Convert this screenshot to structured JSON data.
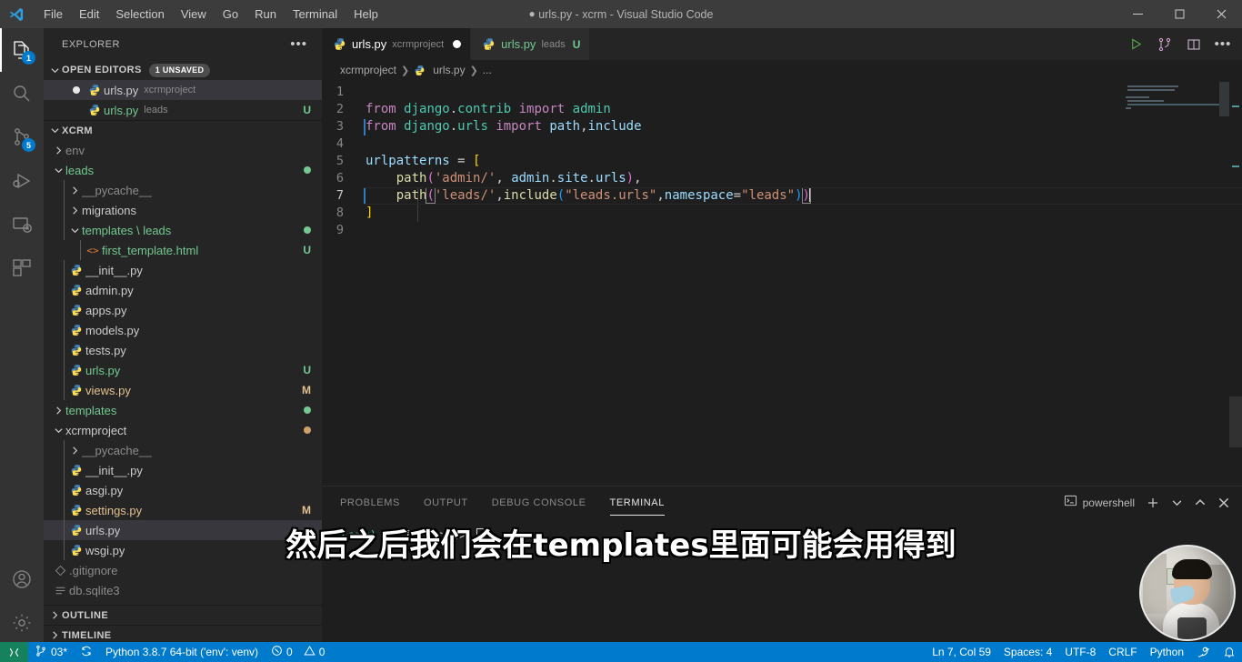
{
  "titlebar": {
    "logo_icon": "vscode-logo-icon",
    "menus": [
      "File",
      "Edit",
      "Selection",
      "View",
      "Go",
      "Run",
      "Terminal",
      "Help"
    ],
    "window_title": "urls.py - xcrm - Visual Studio Code",
    "dirty_indicator": "●",
    "controls": [
      "minimize-icon",
      "maximize-icon",
      "close-icon"
    ]
  },
  "activitybar": {
    "items": [
      {
        "name": "explorer",
        "icon": "files-icon",
        "badge": "1",
        "active": true
      },
      {
        "name": "search",
        "icon": "search-icon",
        "badge": "",
        "active": false
      },
      {
        "name": "source-control",
        "icon": "source-control-icon",
        "badge": "5",
        "active": false
      },
      {
        "name": "run-and-debug",
        "icon": "run-debug-icon",
        "badge": "",
        "active": false
      },
      {
        "name": "remote-explorer",
        "icon": "remote-explorer-icon",
        "badge": "",
        "active": false
      },
      {
        "name": "extensions",
        "icon": "extensions-icon",
        "badge": "",
        "active": false
      }
    ],
    "bottom": [
      {
        "name": "accounts",
        "icon": "account-icon"
      },
      {
        "name": "manage",
        "icon": "gear-icon"
      }
    ]
  },
  "sidebar": {
    "title": "EXPLORER",
    "more_actions_icon": "ellipsis-icon",
    "open_editors": {
      "label": "OPEN EDITORS",
      "badge": "1 UNSAVED",
      "expanded": true,
      "items": [
        {
          "name": "urls.py",
          "desc": "xcrmproject",
          "icon": "python-icon",
          "dirty": true,
          "state": ""
        },
        {
          "name": "urls.py",
          "desc": "leads",
          "icon": "python-icon",
          "dirty": false,
          "state": "U"
        }
      ]
    },
    "workspace": {
      "label": "XCRM",
      "expanded": true,
      "tree": [
        {
          "label": "env",
          "depth": 1,
          "kind": "folder",
          "open": false,
          "color": "grey",
          "state": "",
          "dot": ""
        },
        {
          "label": "leads",
          "depth": 1,
          "kind": "folder",
          "open": true,
          "color": "green",
          "state": "",
          "dot": "green"
        },
        {
          "label": "__pycache__",
          "depth": 2,
          "kind": "folder",
          "open": false,
          "color": "grey",
          "state": "",
          "dot": ""
        },
        {
          "label": "migrations",
          "depth": 2,
          "kind": "folder",
          "open": false,
          "color": "white",
          "state": "",
          "dot": ""
        },
        {
          "label": "templates \\ leads",
          "depth": 2,
          "kind": "folder",
          "open": true,
          "color": "green",
          "state": "",
          "dot": "green"
        },
        {
          "label": "first_template.html",
          "depth": 3,
          "kind": "html",
          "open": false,
          "color": "green",
          "state": "U",
          "dot": ""
        },
        {
          "label": "__init__.py",
          "depth": 2,
          "kind": "python",
          "open": false,
          "color": "white",
          "state": "",
          "dot": ""
        },
        {
          "label": "admin.py",
          "depth": 2,
          "kind": "python",
          "open": false,
          "color": "white",
          "state": "",
          "dot": ""
        },
        {
          "label": "apps.py",
          "depth": 2,
          "kind": "python",
          "open": false,
          "color": "white",
          "state": "",
          "dot": ""
        },
        {
          "label": "models.py",
          "depth": 2,
          "kind": "python",
          "open": false,
          "color": "white",
          "state": "",
          "dot": ""
        },
        {
          "label": "tests.py",
          "depth": 2,
          "kind": "python",
          "open": false,
          "color": "white",
          "state": "",
          "dot": ""
        },
        {
          "label": "urls.py",
          "depth": 2,
          "kind": "python",
          "open": false,
          "color": "green",
          "state": "U",
          "dot": ""
        },
        {
          "label": "views.py",
          "depth": 2,
          "kind": "python",
          "open": false,
          "color": "tan",
          "state": "M",
          "dot": ""
        },
        {
          "label": "templates",
          "depth": 1,
          "kind": "folder",
          "open": false,
          "color": "green",
          "state": "",
          "dot": "green"
        },
        {
          "label": "xcrmproject",
          "depth": 1,
          "kind": "folder",
          "open": true,
          "color": "white",
          "state": "",
          "dot": "tan"
        },
        {
          "label": "__pycache__",
          "depth": 2,
          "kind": "folder",
          "open": false,
          "color": "grey",
          "state": "",
          "dot": ""
        },
        {
          "label": "__init__.py",
          "depth": 2,
          "kind": "python",
          "open": false,
          "color": "white",
          "state": "",
          "dot": ""
        },
        {
          "label": "asgi.py",
          "depth": 2,
          "kind": "python",
          "open": false,
          "color": "white",
          "state": "",
          "dot": ""
        },
        {
          "label": "settings.py",
          "depth": 2,
          "kind": "python",
          "open": false,
          "color": "tan",
          "state": "M",
          "dot": ""
        },
        {
          "label": "urls.py",
          "depth": 2,
          "kind": "python",
          "open": false,
          "color": "white",
          "state": "",
          "dot": "",
          "selected": true
        },
        {
          "label": "wsgi.py",
          "depth": 2,
          "kind": "python",
          "open": false,
          "color": "white",
          "state": "",
          "dot": ""
        },
        {
          "label": ".gitignore",
          "depth": 1,
          "kind": "git",
          "open": false,
          "color": "grey",
          "state": "",
          "dot": ""
        },
        {
          "label": "db.sqlite3",
          "depth": 1,
          "kind": "db",
          "open": false,
          "color": "grey",
          "state": "",
          "dot": ""
        }
      ]
    },
    "outline": {
      "label": "OUTLINE",
      "expanded": false
    },
    "timeline": {
      "label": "TIMELINE",
      "expanded": false
    }
  },
  "editor": {
    "tabs": [
      {
        "name": "urls.py",
        "desc": "xcrmproject",
        "icon": "python-icon",
        "active": true,
        "dirty": true,
        "state": ""
      },
      {
        "name": "urls.py",
        "desc": "leads",
        "icon": "python-icon",
        "active": false,
        "dirty": false,
        "state": "U"
      }
    ],
    "actions": [
      {
        "name": "run-python-file",
        "icon": "play-icon"
      },
      {
        "name": "run-menu",
        "icon": "run-fork-icon"
      },
      {
        "name": "split-editor",
        "icon": "split-editor-icon"
      },
      {
        "name": "more-actions",
        "icon": "ellipsis-icon"
      }
    ],
    "breadcrumbs": [
      "xcrmproject",
      "urls.py",
      "..."
    ],
    "lines": [
      {
        "n": 1,
        "text": ""
      },
      {
        "n": 2,
        "text": "from django.contrib import admin"
      },
      {
        "n": 3,
        "text": "from django.urls import path,include"
      },
      {
        "n": 4,
        "text": ""
      },
      {
        "n": 5,
        "text": "urlpatterns = ["
      },
      {
        "n": 6,
        "text": "    path('admin/', admin.site.urls),"
      },
      {
        "n": 7,
        "text": "    path('leads/',include(\"leads.urls\",namespace=\"leads\"))"
      },
      {
        "n": 8,
        "text": "]"
      },
      {
        "n": 9,
        "text": ""
      }
    ],
    "cursor_line": 7,
    "modified_lines": [
      3,
      7
    ]
  },
  "panel": {
    "tabs": [
      "PROBLEMS",
      "OUTPUT",
      "DEBUG CONSOLE",
      "TERMINAL"
    ],
    "active_tab": "TERMINAL",
    "shell": {
      "icon": "terminal-powershell-icon",
      "name": "powershell"
    },
    "actions": [
      {
        "name": "new-terminal",
        "icon": "plus-icon"
      },
      {
        "name": "terminal-dropdown",
        "icon": "chevron-down-icon"
      },
      {
        "name": "maximize-panel",
        "icon": "chevron-up-icon"
      },
      {
        "name": "close-panel",
        "icon": "close-icon"
      }
    ],
    "terminal": {
      "env": "(env)",
      "prompt": "PS D:\\xcrm>"
    }
  },
  "statusbar": {
    "remote_icon": "remote-indicator-icon",
    "branch": {
      "icon": "git-branch-icon",
      "label": "03*"
    },
    "sync_icon": "sync-icon",
    "interpreter": "Python 3.8.7 64-bit ('env': venv)",
    "errors": {
      "icon": "error-icon",
      "count": "0"
    },
    "warnings": {
      "icon": "warning-icon",
      "count": "0"
    },
    "cursor_position": "Ln 7, Col 59",
    "indentation": "Spaces: 4",
    "encoding": "UTF-8",
    "eol": "CRLF",
    "language": "Python",
    "feedback_icon": "tweet-feedback-icon",
    "bell_icon": "bell-icon"
  },
  "overlay": {
    "subtitle": "然后之后我们会在templates里面可能会用得到",
    "webcam_label": "presenter-webcam"
  },
  "colors": {
    "accent": "#007acc",
    "remote_green": "#16825d",
    "added_green": "#73c991",
    "modified_tan": "#e2c08d",
    "editor_bg": "#1e1e1e",
    "sidebar_bg": "#252526",
    "titlebar_bg": "#3c3c3c"
  }
}
